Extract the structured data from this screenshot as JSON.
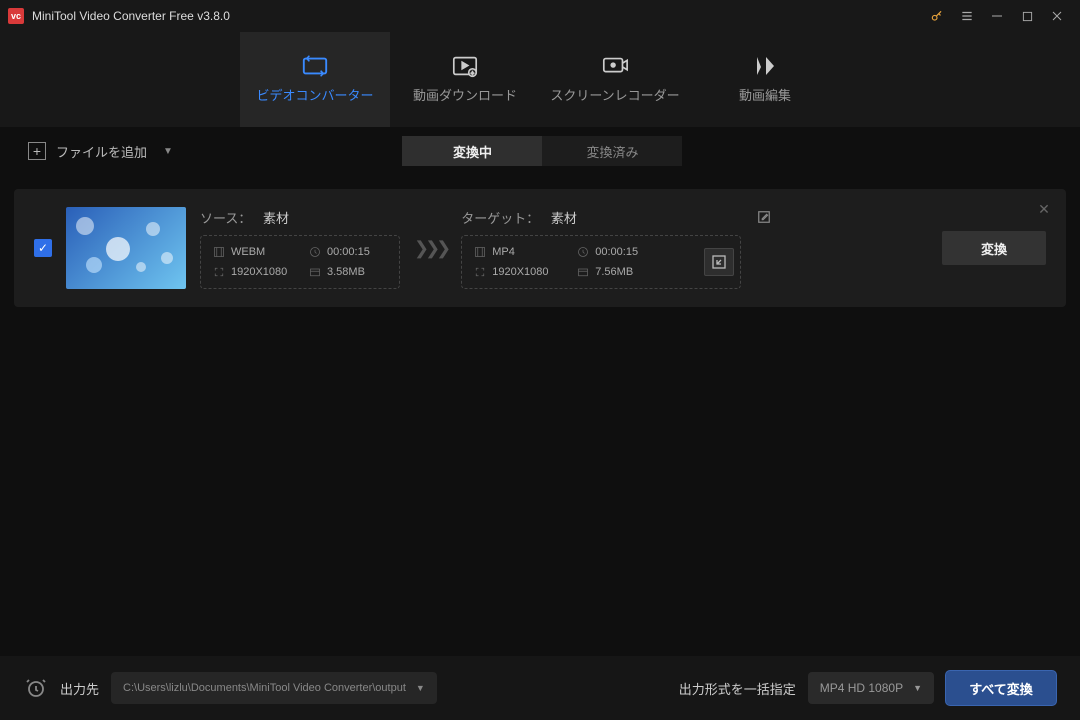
{
  "titlebar": {
    "title": "MiniTool Video Converter Free v3.8.0",
    "logo_text": "vc"
  },
  "main_tabs": [
    {
      "label": "ビデオコンバーター"
    },
    {
      "label": "動画ダウンロード"
    },
    {
      "label": "スクリーンレコーダー"
    },
    {
      "label": "動画編集"
    }
  ],
  "toolbar": {
    "add_file": "ファイルを追加",
    "seg_converting": "変換中",
    "seg_done": "変換済み"
  },
  "item": {
    "source_label": "ソース： ",
    "source_name": "素材",
    "target_label": "ターゲット： ",
    "target_name": "素材",
    "src": {
      "format": "WEBM",
      "duration": "00:00:15",
      "resolution": "1920X1080",
      "size": "3.58MB"
    },
    "dst": {
      "format": "MP4",
      "duration": "00:00:15",
      "resolution": "1920X1080",
      "size": "7.56MB"
    },
    "convert_btn": "変換"
  },
  "bottom": {
    "output_label": "出力先",
    "output_path": "C:\\Users\\lizlu\\Documents\\MiniTool Video Converter\\output",
    "batch_format_label": "出力形式を一括指定",
    "batch_format_value": "MP4 HD 1080P",
    "all_convert": "すべて変換"
  }
}
